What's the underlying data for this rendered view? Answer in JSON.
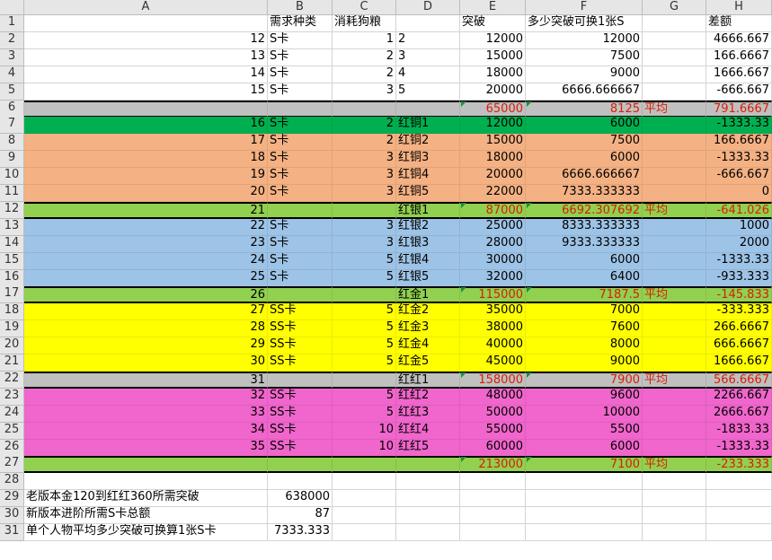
{
  "columns": [
    "A",
    "B",
    "C",
    "D",
    "E",
    "F",
    "G",
    "H"
  ],
  "colors": {
    "gray": "#c0c0c0",
    "green_dark": "#00b050",
    "green_light": "#92d050",
    "orange": "#f4b183",
    "blue": "#9dc3e6",
    "yellow": "#ffff00",
    "magenta": "#f066cc",
    "red_text": "#d81e06"
  },
  "rows": [
    {
      "n": "1",
      "band": "",
      "cells": {
        "B": "需求种类",
        "C": "消耗狗粮",
        "E": "突破",
        "F": "多少突破可换1张S",
        "H": "差额"
      }
    },
    {
      "n": "2",
      "band": "",
      "cells": {
        "A": "12",
        "B": "S卡",
        "C": "1",
        "D": "2",
        "E": "12000",
        "F": "12000",
        "H": "4666.667"
      }
    },
    {
      "n": "3",
      "band": "",
      "cells": {
        "A": "13",
        "B": "S卡",
        "C": "2",
        "D": "3",
        "E": "15000",
        "F": "7500",
        "H": "166.6667"
      }
    },
    {
      "n": "4",
      "band": "",
      "cells": {
        "A": "14",
        "B": "S卡",
        "C": "2",
        "D": "4",
        "E": "18000",
        "F": "9000",
        "H": "1666.667"
      }
    },
    {
      "n": "5",
      "band": "",
      "cells": {
        "A": "15",
        "B": "S卡",
        "C": "3",
        "D": "5",
        "E": "20000",
        "F": "6666.666667",
        "H": "-666.667"
      }
    },
    {
      "n": "6",
      "band": "gray",
      "sum": true,
      "cells": {
        "E": "65000",
        "F": "8125",
        "G": "平均",
        "H": "791.6667"
      }
    },
    {
      "n": "7",
      "band": "green_dark",
      "cells": {
        "A": "16",
        "B": "S卡",
        "C": "2",
        "D": "红铜1",
        "E": "12000",
        "F": "6000",
        "H": "-1333.33"
      }
    },
    {
      "n": "8",
      "band": "orange",
      "cells": {
        "A": "17",
        "B": "S卡",
        "C": "2",
        "D": "红铜2",
        "E": "15000",
        "F": "7500",
        "H": "166.6667"
      }
    },
    {
      "n": "9",
      "band": "orange",
      "cells": {
        "A": "18",
        "B": "S卡",
        "C": "3",
        "D": "红铜3",
        "E": "18000",
        "F": "6000",
        "H": "-1333.33"
      }
    },
    {
      "n": "10",
      "band": "orange",
      "cells": {
        "A": "19",
        "B": "S卡",
        "C": "3",
        "D": "红铜4",
        "E": "20000",
        "F": "6666.666667",
        "H": "-666.667"
      }
    },
    {
      "n": "11",
      "band": "orange",
      "cells": {
        "A": "20",
        "B": "S卡",
        "C": "3",
        "D": "红铜5",
        "E": "22000",
        "F": "7333.333333",
        "H": "0"
      }
    },
    {
      "n": "12",
      "band": "green_light",
      "sum": true,
      "cells": {
        "A": "21",
        "D": "红银1",
        "E": "87000",
        "F": "6692.307692",
        "G": "平均",
        "H": "-641.026"
      }
    },
    {
      "n": "13",
      "band": "blue",
      "cells": {
        "A": "22",
        "B": "S卡",
        "C": "3",
        "D": "红银2",
        "E": "25000",
        "F": "8333.333333",
        "H": "1000"
      }
    },
    {
      "n": "14",
      "band": "blue",
      "cells": {
        "A": "23",
        "B": "S卡",
        "C": "3",
        "D": "红银3",
        "E": "28000",
        "F": "9333.333333",
        "H": "2000"
      }
    },
    {
      "n": "15",
      "band": "blue",
      "cells": {
        "A": "24",
        "B": "S卡",
        "C": "5",
        "D": "红银4",
        "E": "30000",
        "F": "6000",
        "H": "-1333.33"
      }
    },
    {
      "n": "16",
      "band": "blue",
      "cells": {
        "A": "25",
        "B": "S卡",
        "C": "5",
        "D": "红银5",
        "E": "32000",
        "F": "6400",
        "H": "-933.333"
      }
    },
    {
      "n": "17",
      "band": "green_light",
      "sum": true,
      "cells": {
        "A": "26",
        "D": "红金1",
        "E": "115000",
        "F": "7187.5",
        "G": "平均",
        "H": "-145.833"
      }
    },
    {
      "n": "18",
      "band": "yellow",
      "cells": {
        "A": "27",
        "B": "SS卡",
        "C": "5",
        "D": "红金2",
        "E": "35000",
        "F": "7000",
        "H": "-333.333"
      }
    },
    {
      "n": "19",
      "band": "yellow",
      "cells": {
        "A": "28",
        "B": "SS卡",
        "C": "5",
        "D": "红金3",
        "E": "38000",
        "F": "7600",
        "H": "266.6667"
      }
    },
    {
      "n": "20",
      "band": "yellow",
      "cells": {
        "A": "29",
        "B": "SS卡",
        "C": "5",
        "D": "红金4",
        "E": "40000",
        "F": "8000",
        "H": "666.6667"
      }
    },
    {
      "n": "21",
      "band": "yellow",
      "cells": {
        "A": "30",
        "B": "SS卡",
        "C": "5",
        "D": "红金5",
        "E": "45000",
        "F": "9000",
        "H": "1666.667"
      }
    },
    {
      "n": "22",
      "band": "gray",
      "sum": true,
      "cells": {
        "A": "31",
        "D": "红红1",
        "E": "158000",
        "F": "7900",
        "G": "平均",
        "H": "566.6667"
      }
    },
    {
      "n": "23",
      "band": "magenta",
      "cells": {
        "A": "32",
        "B": "SS卡",
        "C": "5",
        "D": "红红2",
        "E": "48000",
        "F": "9600",
        "H": "2266.667"
      }
    },
    {
      "n": "24",
      "band": "magenta",
      "cells": {
        "A": "33",
        "B": "SS卡",
        "C": "5",
        "D": "红红3",
        "E": "50000",
        "F": "10000",
        "H": "2666.667"
      }
    },
    {
      "n": "25",
      "band": "magenta",
      "cells": {
        "A": "34",
        "B": "SS卡",
        "C": "10",
        "D": "红红4",
        "E": "55000",
        "F": "5500",
        "H": "-1833.33"
      }
    },
    {
      "n": "26",
      "band": "magenta",
      "cells": {
        "A": "35",
        "B": "SS卡",
        "C": "10",
        "D": "红红5",
        "E": "60000",
        "F": "6000",
        "H": "-1333.33"
      }
    },
    {
      "n": "27",
      "band": "green_light",
      "sum": true,
      "cells": {
        "E": "213000",
        "F": "7100",
        "G": "平均",
        "H": "-233.333"
      }
    },
    {
      "n": "28",
      "band": "",
      "cells": {}
    },
    {
      "n": "29",
      "band": "",
      "cells": {
        "A": "老版本金120到红红360所需突破",
        "B": "638000"
      }
    },
    {
      "n": "30",
      "band": "",
      "cells": {
        "A": "新版本进阶所需S卡总额",
        "B": "87"
      }
    },
    {
      "n": "31",
      "band": "",
      "cells": {
        "A": "单个人物平均多少突破可换算1张S卡",
        "B": "7333.333"
      }
    }
  ]
}
